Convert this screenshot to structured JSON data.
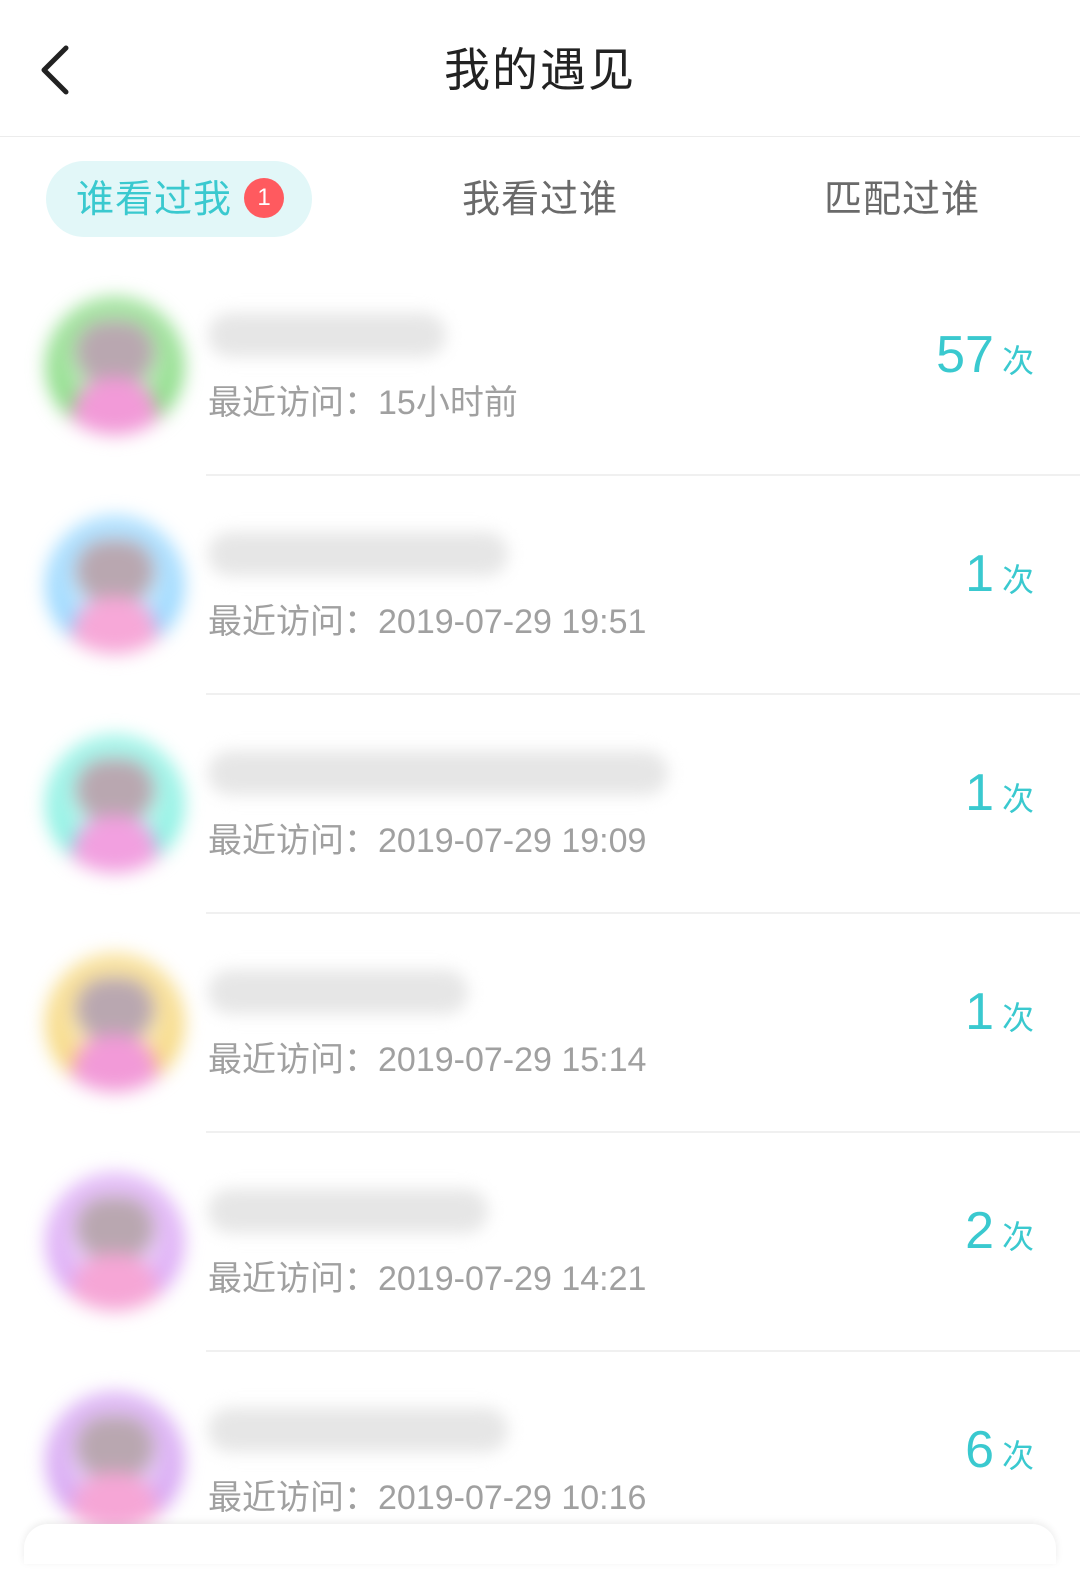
{
  "header": {
    "title": "我的遇见",
    "back_icon": "chevron-left-icon"
  },
  "tabs": [
    {
      "label": "谁看过我",
      "badge": "1",
      "active": true
    },
    {
      "label": "我看过谁",
      "active": false
    },
    {
      "label": "匹配过谁",
      "active": false
    }
  ],
  "colors": {
    "accent": "#3ac9cf",
    "tab_active_bg": "#e2f7f8",
    "badge": "#ff5a5f",
    "muted_text": "#a0a0a0"
  },
  "visitors": [
    {
      "visit_label": "最近访问：",
      "visit_time": "15小时前",
      "count": "57",
      "count_unit": "次",
      "avatar_color_a": "#7fd97a",
      "avatar_color_b": "#f29ad8"
    },
    {
      "visit_label": "最近访问：",
      "visit_time": "2019-07-29 19:51",
      "count": "1",
      "count_unit": "次",
      "avatar_color_a": "#8fd4ff",
      "avatar_color_b": "#f7a8d8"
    },
    {
      "visit_label": "最近访问：",
      "visit_time": "2019-07-29 19:09",
      "count": "1",
      "count_unit": "次",
      "avatar_color_a": "#7ff0e0",
      "avatar_color_b": "#f2a0e0"
    },
    {
      "visit_label": "最近访问：",
      "visit_time": "2019-07-29 15:14",
      "count": "1",
      "count_unit": "次",
      "avatar_color_a": "#f6d574",
      "avatar_color_b": "#f29ad8"
    },
    {
      "visit_label": "最近访问：",
      "visit_time": "2019-07-29 14:21",
      "count": "2",
      "count_unit": "次",
      "avatar_color_a": "#d9a2f5",
      "avatar_color_b": "#f6a6d6"
    },
    {
      "visit_label": "最近访问：",
      "visit_time": "2019-07-29 10:16",
      "count": "6",
      "count_unit": "次",
      "avatar_color_a": "#d29cf2",
      "avatar_color_b": "#f6a6d6"
    }
  ]
}
